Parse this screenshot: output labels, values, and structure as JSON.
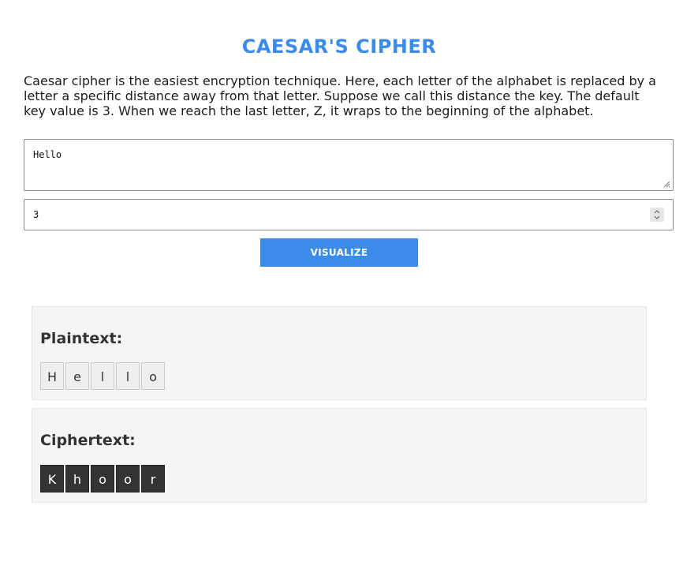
{
  "header": {
    "title": "CAESAR'S CIPHER",
    "description": "Caesar cipher is the easiest encryption technique. Here, each letter of the alphabet is replaced by a letter a specific distance away from that letter. Suppose we call this distance the key. The default key value is 3. When we reach the last letter, Z, it wraps to the beginning of the alphabet."
  },
  "form": {
    "plaintext_value": "Hello",
    "key_value": "3",
    "visualize_label": "VISUALIZE"
  },
  "plaintext_panel": {
    "heading": "Plaintext:",
    "letters": [
      "H",
      "e",
      "l",
      "l",
      "o"
    ]
  },
  "ciphertext_panel": {
    "heading": "Ciphertext:",
    "letters": [
      "K",
      "h",
      "o",
      "o",
      "r"
    ]
  },
  "colors": {
    "accent": "#3b8beb",
    "cipher_cell": "#333333",
    "plain_cell": "#eeeeee"
  }
}
